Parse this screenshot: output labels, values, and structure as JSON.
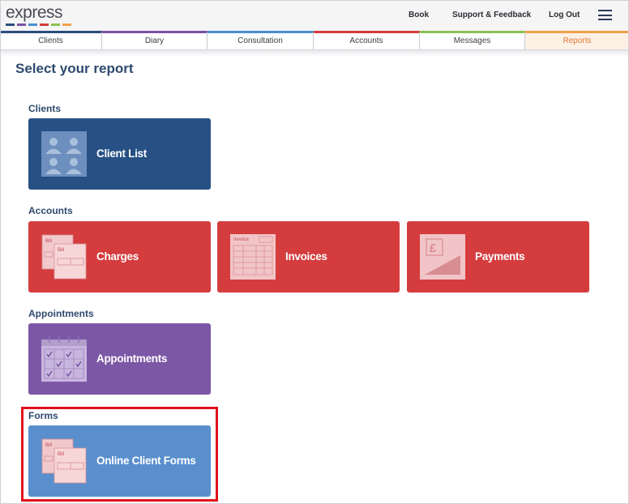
{
  "header": {
    "logo_text": "express",
    "logo_colors": [
      "#2b4d7e",
      "#7b52a3",
      "#4a8fd0",
      "#d43c3c",
      "#8cc152",
      "#f0a04b"
    ],
    "nav": {
      "book": "Book",
      "support": "Support & Feedback",
      "logout": "Log Out"
    },
    "menu_icon": "hamburger-icon"
  },
  "tabs": [
    {
      "label": "Clients",
      "color": "#2b4d7e"
    },
    {
      "label": "Diary",
      "color": "#7b52a3"
    },
    {
      "label": "Consultation",
      "color": "#4a8fd0"
    },
    {
      "label": "Accounts",
      "color": "#d43c3c"
    },
    {
      "label": "Messages",
      "color": "#8cc152"
    },
    {
      "label": "Reports",
      "color": "#f0a04b",
      "active": true
    }
  ],
  "page": {
    "title": "Select your report"
  },
  "sections": {
    "clients": {
      "label": "Clients",
      "cards": {
        "client_list": "Client List"
      }
    },
    "accounts": {
      "label": "Accounts",
      "cards": {
        "charges": "Charges",
        "invoices": "Invoices",
        "payments": "Payments"
      }
    },
    "appointments": {
      "label": "Appointments",
      "cards": {
        "appointments": "Appointments"
      }
    },
    "forms": {
      "label": "Forms",
      "cards": {
        "online_client_forms": "Online Client Forms"
      }
    }
  },
  "icon_text": {
    "bill_a": "Bill",
    "bill_b": "Bill",
    "invoice": "Invoice",
    "pound": "£"
  },
  "colors": {
    "clients_card": "#275185",
    "accounts_card": "#d43c3e",
    "appointments_card": "#7c57a6",
    "forms_card": "#5a8fcd",
    "highlight": "#e0121c"
  }
}
